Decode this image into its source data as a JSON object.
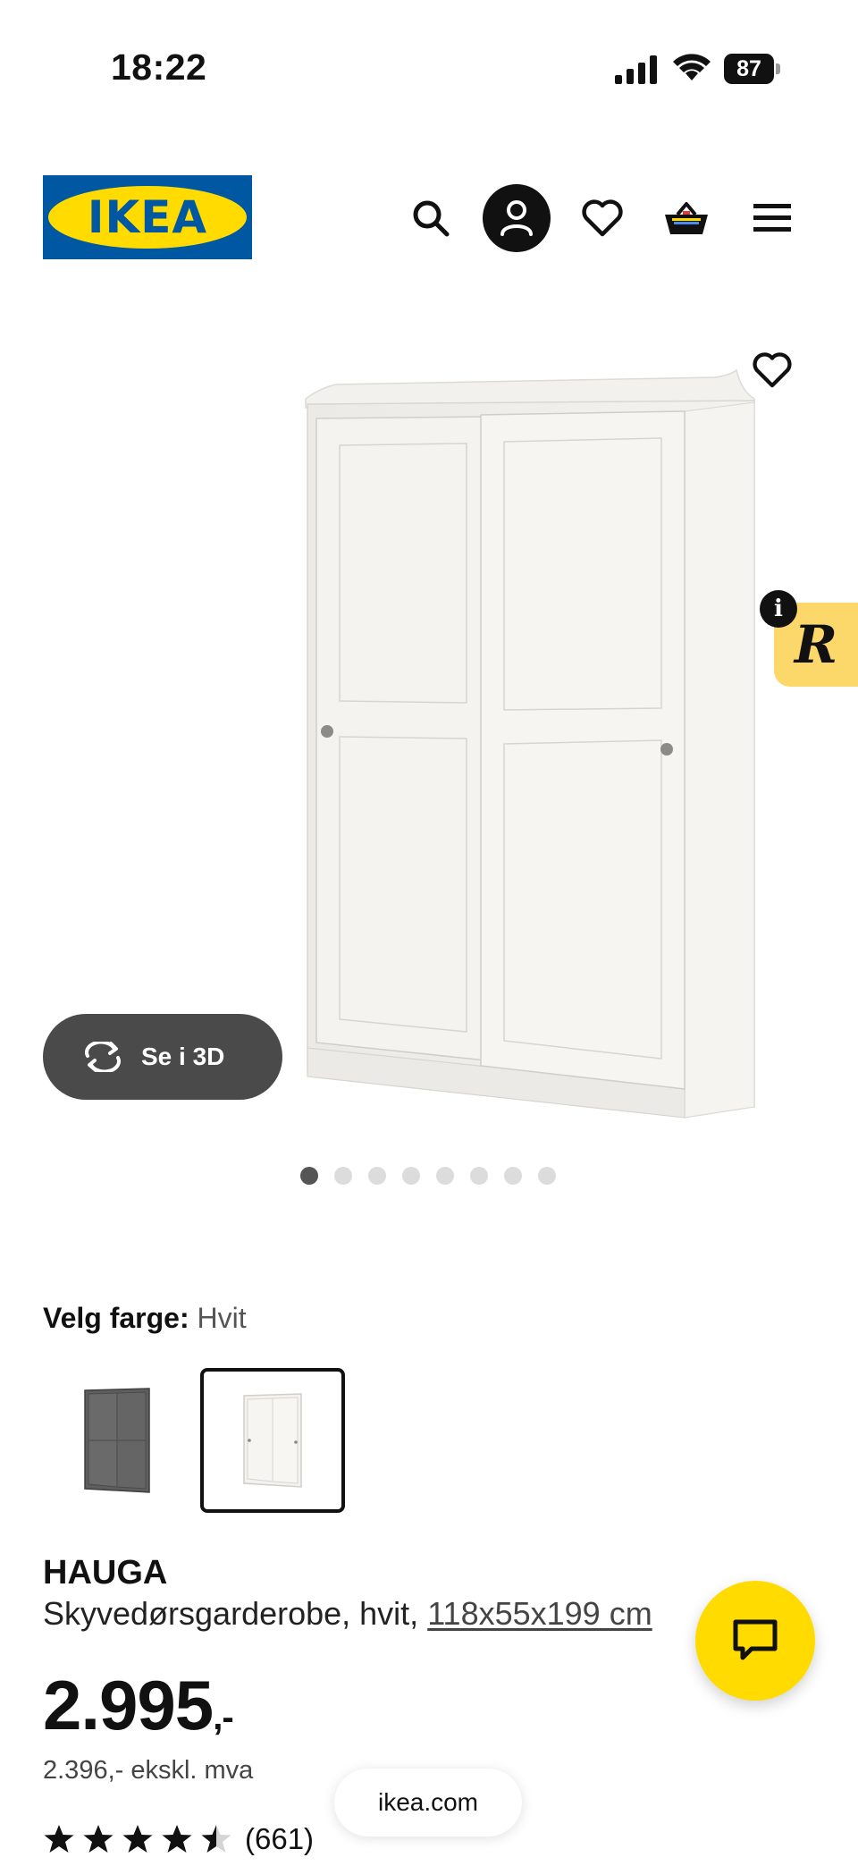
{
  "status_bar": {
    "time": "18:22",
    "battery": "87"
  },
  "header": {
    "logo_text": "IKEA",
    "icons": [
      "search-icon",
      "profile-icon",
      "heart-icon",
      "basket-icon",
      "menu-icon"
    ]
  },
  "gallery": {
    "view_3d_label": "Se i 3D",
    "dot_count": 8,
    "active_dot": 1,
    "badge_letter": "R",
    "info_letter": "i"
  },
  "color_select": {
    "label": "Velg farge:",
    "value": "Hvit",
    "options": [
      "dark-grey",
      "white"
    ],
    "selected": "white"
  },
  "product": {
    "name": "HAUGA",
    "description": "Skyvedørsgarderobe, hvit,",
    "dimensions": "118x55x199 cm",
    "price_main": "2.995",
    "price_suffix": ",-",
    "price_ex_vat": "2.396,- ekskl. mva",
    "rating": 4.5,
    "rating_count": "(661)"
  },
  "browser": {
    "url": "ikea.com"
  },
  "colors": {
    "brand_blue": "#0058a3",
    "brand_yellow": "#ffdb00",
    "badge_yellow": "#fcd86b"
  }
}
